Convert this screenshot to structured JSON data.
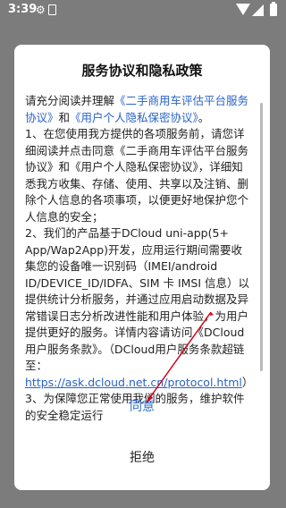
{
  "status": {
    "time": "3:39",
    "icons": [
      "settings-icon",
      "sim-icon",
      "wifi-icon",
      "signal-icon",
      "battery-icon"
    ]
  },
  "dialog": {
    "title": "服务协议和隐私政策",
    "intro_prefix": "请充分阅读并理解",
    "link_service": "《二手商用车评估平台服务协议》",
    "and": "和",
    "link_privacy": "《用户个人隐私保密协议》",
    "intro_suffix": "。",
    "p1_prefix": "1、在您使用我方提供的各项服务前，请您详细阅读并点击同意",
    "p1_middle": "和",
    "p1_suffix": "，详细知悉我方收集、存储、使用、共享以及注销、删除个人信息的各项事项，以便更好地保护您个人信息的安全；",
    "p1_service": "《二手商用车评估平台服务协议》",
    "p1_privacy": "《用户个人隐私保密协议》",
    "p2_a": "2、我们的产品基于DCloud uni-app(5+ App/Wap2App)开发，应用运行期间需要收集您的设备唯一识别码（IMEI/android ID/DEVICE_ID/IDFA、SIM 卡 IMSI 信息）以提供统计分析服务，并通过应用启动数据及异常错误日志分析改进性能和用户体验，为用户提供更好的服务。详情内容请访问",
    "p2_link": "《DCloud用户服务条款》",
    "p2_b": "。（DCloud用户服务条款超链至：",
    "p2_url": "https://ask.dcloud.net.cn/protocol.html",
    "p2_c": "）",
    "p3": "3、为保障您正常使用我们的服务，维护软件的安全稳定运行",
    "agree_label": "同意",
    "reject_label": "拒绝"
  },
  "colors": {
    "accent": "#2b6fd1",
    "link": "#2a63c7",
    "arrow": "#d0021b",
    "overlay": "#7c7c7c"
  }
}
